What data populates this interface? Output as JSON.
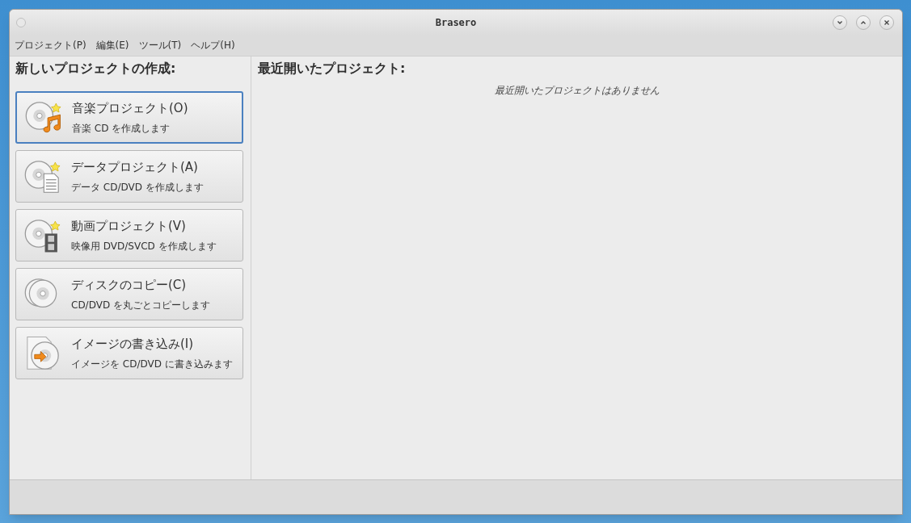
{
  "window": {
    "title": "Brasero"
  },
  "menu": [
    {
      "label": "プロジェクト(P)"
    },
    {
      "label": "編集(E)"
    },
    {
      "label": "ツール(T)"
    },
    {
      "label": "ヘルプ(H)"
    }
  ],
  "new_project": {
    "heading": "新しいプロジェクトの作成:",
    "items": [
      {
        "kind": "music",
        "title": "音楽プロジェクト(O)",
        "subtitle": "音楽 CD を作成します",
        "selected": true
      },
      {
        "kind": "data",
        "title": "データプロジェクト(A)",
        "subtitle": "データ CD/DVD を作成します",
        "selected": false
      },
      {
        "kind": "video",
        "title": "動画プロジェクト(V)",
        "subtitle": "映像用 DVD/SVCD を作成します",
        "selected": false
      },
      {
        "kind": "copy",
        "title": "ディスクのコピー(C)",
        "subtitle": "CD/DVD を丸ごとコピーします",
        "selected": false
      },
      {
        "kind": "image",
        "title": "イメージの書き込み(I)",
        "subtitle": "イメージを CD/DVD に書き込みます",
        "selected": false
      }
    ]
  },
  "recent": {
    "heading": "最近開いたプロジェクト:",
    "empty_text": "最近開いたプロジェクトはありません"
  }
}
